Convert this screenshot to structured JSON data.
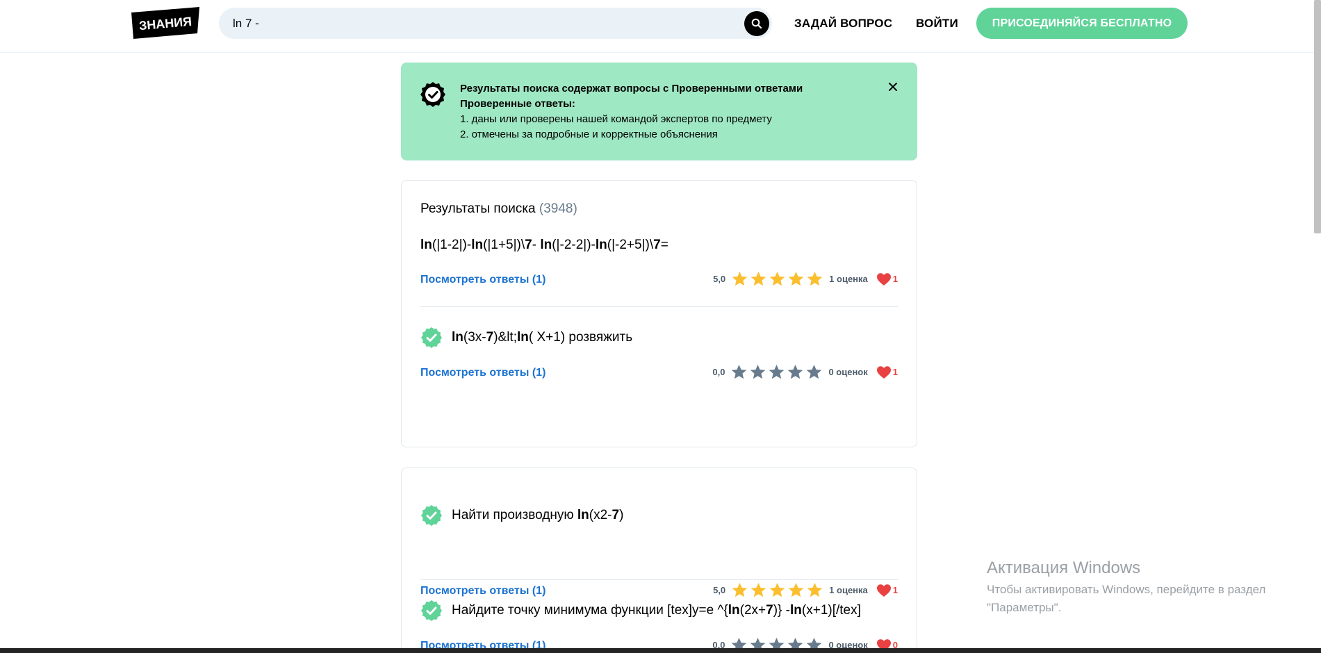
{
  "header": {
    "logo_text": "ЗНАНИЯ",
    "search_value": "ln 7 -",
    "ask_label": "ЗАДАЙ ВОПРОС",
    "login_label": "ВОЙТИ",
    "join_label": "ПРИСОЕДИНЯЙСЯ БЕСПЛАТНО"
  },
  "banner": {
    "title": "Результаты поиска содержат вопросы с Проверенными ответами",
    "subtitle": "Проверенные ответы:",
    "line1": "1. даны или проверены нашей командой экспертов по предмету",
    "line2": "2. отмечены за подробные и корректные объяснения"
  },
  "results": {
    "label": "Результаты поиска",
    "count": "(3948)"
  },
  "questions": [
    {
      "text": "ln(|1-2|)-ln(|1+5|)\\7- ln(|-2-2|)-ln(|-2+5|)\\7=",
      "link": "Посмотреть ответы (1)",
      "rating": "5,0",
      "stars_filled": 5,
      "rating_count": "1 оценка",
      "likes": "1"
    },
    {
      "text": "ln(3x-7)&lt;ln( X+1) розвяжить",
      "link": "Посмотреть ответы (1)",
      "rating": "0,0",
      "stars_filled": 0,
      "rating_count": "0 оценок",
      "likes": "1"
    },
    {
      "text": "Найти производную ln(x2-7)",
      "link": "Посмотреть ответы (1)",
      "rating": "5,0",
      "stars_filled": 5,
      "rating_count": "1 оценка",
      "likes": "1"
    },
    {
      "text": "Найдите точку минимума функции [tex]y=e ^{ln(2x+7)} -ln(x+1)[/tex]",
      "link": "Посмотреть ответы (1)",
      "rating": "0,0",
      "stars_filled": 0,
      "rating_count": "0 оценок",
      "likes": "0"
    }
  ],
  "watermark": {
    "title": "Активация Windows",
    "text": "Чтобы активировать Windows, перейдите в раздел \"Параметры\"."
  },
  "colors": {
    "brand_green": "#60d399",
    "banner_bg": "#9fe8c4",
    "link_blue": "#1c73d1",
    "star_gold": "#fbbe2e",
    "star_gray": "#687b8c",
    "heart_red": "#e94141"
  }
}
